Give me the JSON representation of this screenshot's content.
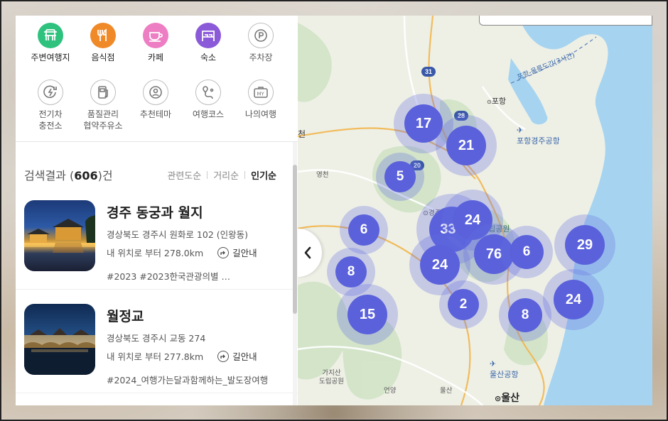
{
  "categories_row1": [
    {
      "label": "주변여행지",
      "icon": "tour-icon",
      "color": "#2ec27e"
    },
    {
      "label": "음식점",
      "icon": "food-icon",
      "color": "#f08a28"
    },
    {
      "label": "카페",
      "icon": "cafe-icon",
      "color": "#ee7ec3"
    },
    {
      "label": "숙소",
      "icon": "bed-icon",
      "color": "#8a5ad8"
    },
    {
      "label": "주차장",
      "icon": "parking-icon",
      "color": "#ffffff"
    }
  ],
  "categories_row2": [
    {
      "label": "전기차\n충전소",
      "icon": "ev-charger-icon"
    },
    {
      "label": "품질관리\n협약주유소",
      "icon": "gas-station-icon"
    },
    {
      "label": "추천테마",
      "icon": "theme-icon"
    },
    {
      "label": "여행코스",
      "icon": "route-icon"
    },
    {
      "label": "나의여행",
      "icon": "my-trip-icon"
    }
  ],
  "results": {
    "prefix": "검색결과 (",
    "count": "606",
    "suffix": ")건",
    "sort_related": "관련도순",
    "sort_distance": "거리순",
    "sort_popular": "인기순"
  },
  "items": [
    {
      "title": "경주 동궁과 월지",
      "address": "경상북도 경주시 원화로 102 (인왕동)",
      "distance": "내 위치로 부터 278.0km",
      "directions": "길안내",
      "tags": "#2023  #2023한국관광의별  …"
    },
    {
      "title": "월정교",
      "address": "경상북도 경주시 교동 274",
      "distance": "내 위치로 부터 277.8km",
      "directions": "길안내",
      "tags": "#2024_여행가는달과함께하는_발도장여행"
    }
  ],
  "map": {
    "labels": {
      "pohang": "포항",
      "pohang_airport": "포항경주공항",
      "gyeongju": "경주",
      "national_park": "국립공원",
      "ulsan": "울산",
      "ulsan_airport": "울산공항",
      "yeongcheon": "영천",
      "cheon": "천",
      "gajisan": "가지산\n도립공원",
      "eonyang": "언양",
      "ulsan_ic": "울산",
      "bridge": "포항-울릉도간(3시간)",
      "road31": "31",
      "road28": "28",
      "road20": "20"
    },
    "clusters": [
      {
        "count": "17"
      },
      {
        "count": "21"
      },
      {
        "count": "5"
      },
      {
        "count": "6"
      },
      {
        "count": "336"
      },
      {
        "count": "24"
      },
      {
        "count": "76"
      },
      {
        "count": "6"
      },
      {
        "count": "29"
      },
      {
        "count": "8"
      },
      {
        "count": "24"
      },
      {
        "count": "15"
      },
      {
        "count": "2"
      },
      {
        "count": "8"
      },
      {
        "count": "24"
      }
    ]
  }
}
